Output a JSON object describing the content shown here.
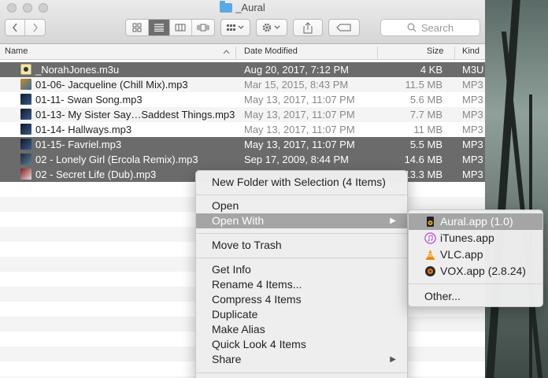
{
  "window": {
    "title": "_Aural"
  },
  "toolbar": {
    "back_icon": "chevron-left-icon",
    "forward_icon": "chevron-right-icon",
    "view_icons": [
      "icon-view-icon",
      "list-view-icon",
      "column-view-icon",
      "cover-flow-icon"
    ],
    "arrange_icon": "arrange-icon",
    "action_icon": "gear-icon",
    "share_icon": "share-icon",
    "tags_icon": "tag-icon",
    "search_label": "Search"
  },
  "columns": {
    "name": "Name",
    "date": "Date Modified",
    "size": "Size",
    "kind": "Kind"
  },
  "files": [
    {
      "name": "_NorahJones.m3u",
      "date": "Aug 20, 2017, 7:12 PM",
      "size": "4 KB",
      "kind": "M3U",
      "selected": true,
      "icon": "playlist"
    },
    {
      "name": "01-06- Jacqueline (Chill Mix).mp3",
      "date": "Mar 15, 2015, 8:43 PM",
      "size": "11.5 MB",
      "kind": "MP3",
      "selected": false,
      "icon": "album"
    },
    {
      "name": "01-11- Swan Song.mp3",
      "date": "May 13, 2017, 11:07 PM",
      "size": "5.6 MB",
      "kind": "MP3",
      "selected": false,
      "icon": "album"
    },
    {
      "name": "01-13- My Sister Say…Saddest Things.mp3",
      "date": "May 13, 2017, 11:07 PM",
      "size": "7.7 MB",
      "kind": "MP3",
      "selected": false,
      "icon": "album"
    },
    {
      "name": "01-14- Hallways.mp3",
      "date": "May 13, 2017, 11:07 PM",
      "size": "11 MB",
      "kind": "MP3",
      "selected": false,
      "icon": "album"
    },
    {
      "name": "01-15- Favriel.mp3",
      "date": "May 13, 2017, 11:07 PM",
      "size": "5.5 MB",
      "kind": "MP3",
      "selected": true,
      "icon": "album"
    },
    {
      "name": "02 - Lonely Girl (Ercola Remix).mp3",
      "date": "Sep 17, 2009, 8:44 PM",
      "size": "14.6 MB",
      "kind": "MP3",
      "selected": true,
      "icon": "album"
    },
    {
      "name": "02 - Secret Life (Dub).mp3",
      "date": "",
      "size": "13.3 MB",
      "kind": "MP3",
      "selected": true,
      "icon": "album"
    }
  ],
  "context_menu": {
    "new_folder": "New Folder with Selection (4 Items)",
    "open": "Open",
    "open_with": "Open With",
    "move_to_trash": "Move to Trash",
    "get_info": "Get Info",
    "rename": "Rename 4 Items...",
    "compress": "Compress 4 Items",
    "duplicate": "Duplicate",
    "make_alias": "Make Alias",
    "quick_look": "Quick Look 4 Items",
    "share": "Share",
    "submenu_arrow": "▶"
  },
  "open_with_menu": {
    "apps": [
      {
        "label": "Aural.app (1.0)",
        "icon": "aural-app-icon",
        "highlighted": true
      },
      {
        "label": "iTunes.app",
        "icon": "itunes-app-icon",
        "highlighted": false
      },
      {
        "label": "VLC.app",
        "icon": "vlc-app-icon",
        "highlighted": false
      },
      {
        "label": "VOX.app (2.8.24)",
        "icon": "vox-app-icon",
        "highlighted": false
      }
    ],
    "other": "Other..."
  },
  "colors": {
    "selection": "#6b6b6b",
    "menu_highlight": "#a5a5a5",
    "folder": "#5aa9e6"
  }
}
